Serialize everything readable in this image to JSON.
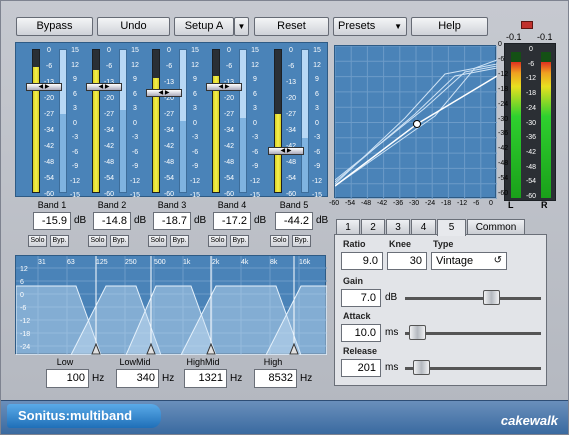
{
  "toolbar": {
    "bypass": "Bypass",
    "undo": "Undo",
    "setup": "Setup A",
    "reset": "Reset",
    "presets": "Presets",
    "help": "Help"
  },
  "meter_scale": [
    "0",
    "-6",
    "-13",
    "-20",
    "-27",
    "-34",
    "-42",
    "-48",
    "-54",
    "-60"
  ],
  "gr_scale": [
    "15",
    "12",
    "9",
    "6",
    "3",
    "0",
    "-3",
    "-6",
    "-9",
    "-12",
    "-15"
  ],
  "bands": [
    {
      "name": "Band 1",
      "value": "-15.9",
      "unit": "dB",
      "solo": "Solo",
      "byp": "Byp.",
      "level": 0.88,
      "gr": 0.45
    },
    {
      "name": "Band 2",
      "value": "-14.8",
      "unit": "dB",
      "solo": "Solo",
      "byp": "Byp.",
      "level": 0.86,
      "gr": 0.42
    },
    {
      "name": "Band 3",
      "value": "-18.7",
      "unit": "dB",
      "solo": "Solo",
      "byp": "Byp.",
      "level": 0.8,
      "gr": 0.5
    },
    {
      "name": "Band 4",
      "value": "-17.2",
      "unit": "dB",
      "solo": "Solo",
      "byp": "Byp.",
      "level": 0.82,
      "gr": 0.48
    },
    {
      "name": "Band 5",
      "value": "-44.2",
      "unit": "dB",
      "solo": "Solo",
      "byp": "Byp.",
      "level": 0.55,
      "gr": 0.62
    }
  ],
  "curve": {
    "y_labels": [
      "0",
      "-6",
      "-12",
      "-18",
      "-24",
      "-30",
      "-36",
      "-42",
      "-48",
      "-54",
      "-60"
    ],
    "x_labels": [
      "-60",
      "-54",
      "-48",
      "-42",
      "-36",
      "-30",
      "-24",
      "-18",
      "-12",
      "-6",
      "0"
    ]
  },
  "output": {
    "peak_l": "-0.1",
    "peak_r": "-0.1",
    "scale": [
      "0",
      "-6",
      "-12",
      "-18",
      "-24",
      "-30",
      "-36",
      "-42",
      "-48",
      "-54",
      "-60"
    ],
    "label_l": "L",
    "label_r": "R",
    "level_l": 0.93,
    "level_r": 0.93
  },
  "tabs": [
    "1",
    "2",
    "3",
    "4",
    "5",
    "Common"
  ],
  "active_tab": "5",
  "params": {
    "ratio_label": "Ratio",
    "ratio": "9.0",
    "knee_label": "Knee",
    "knee": "30",
    "type_label": "Type",
    "type": "Vintage",
    "gain_label": "Gain",
    "gain": "7.0",
    "gain_unit": "dB",
    "attack_label": "Attack",
    "attack": "10.0",
    "attack_unit": "ms",
    "release_label": "Release",
    "release": "201",
    "release_unit": "ms"
  },
  "eq": {
    "freq_labels": [
      "31",
      "63",
      "125",
      "250",
      "500",
      "1k",
      "2k",
      "4k",
      "8k",
      "16k"
    ],
    "db_labels": [
      "12",
      "6",
      "0",
      "-6",
      "-12",
      "-18",
      "-24"
    ]
  },
  "crossovers": [
    {
      "label": "Low",
      "value": "100",
      "unit": "Hz"
    },
    {
      "label": "LowMid",
      "value": "340",
      "unit": "Hz"
    },
    {
      "label": "HighMid",
      "value": "1321",
      "unit": "Hz"
    },
    {
      "label": "High",
      "value": "8532",
      "unit": "Hz"
    }
  ],
  "footer": {
    "product": "Sonitus:multiband",
    "brand": "cakewalk"
  },
  "colors": {
    "panel_blue": "#4a83b8",
    "meter_yellow": "#f5ef50",
    "output_green": "#22c022"
  }
}
